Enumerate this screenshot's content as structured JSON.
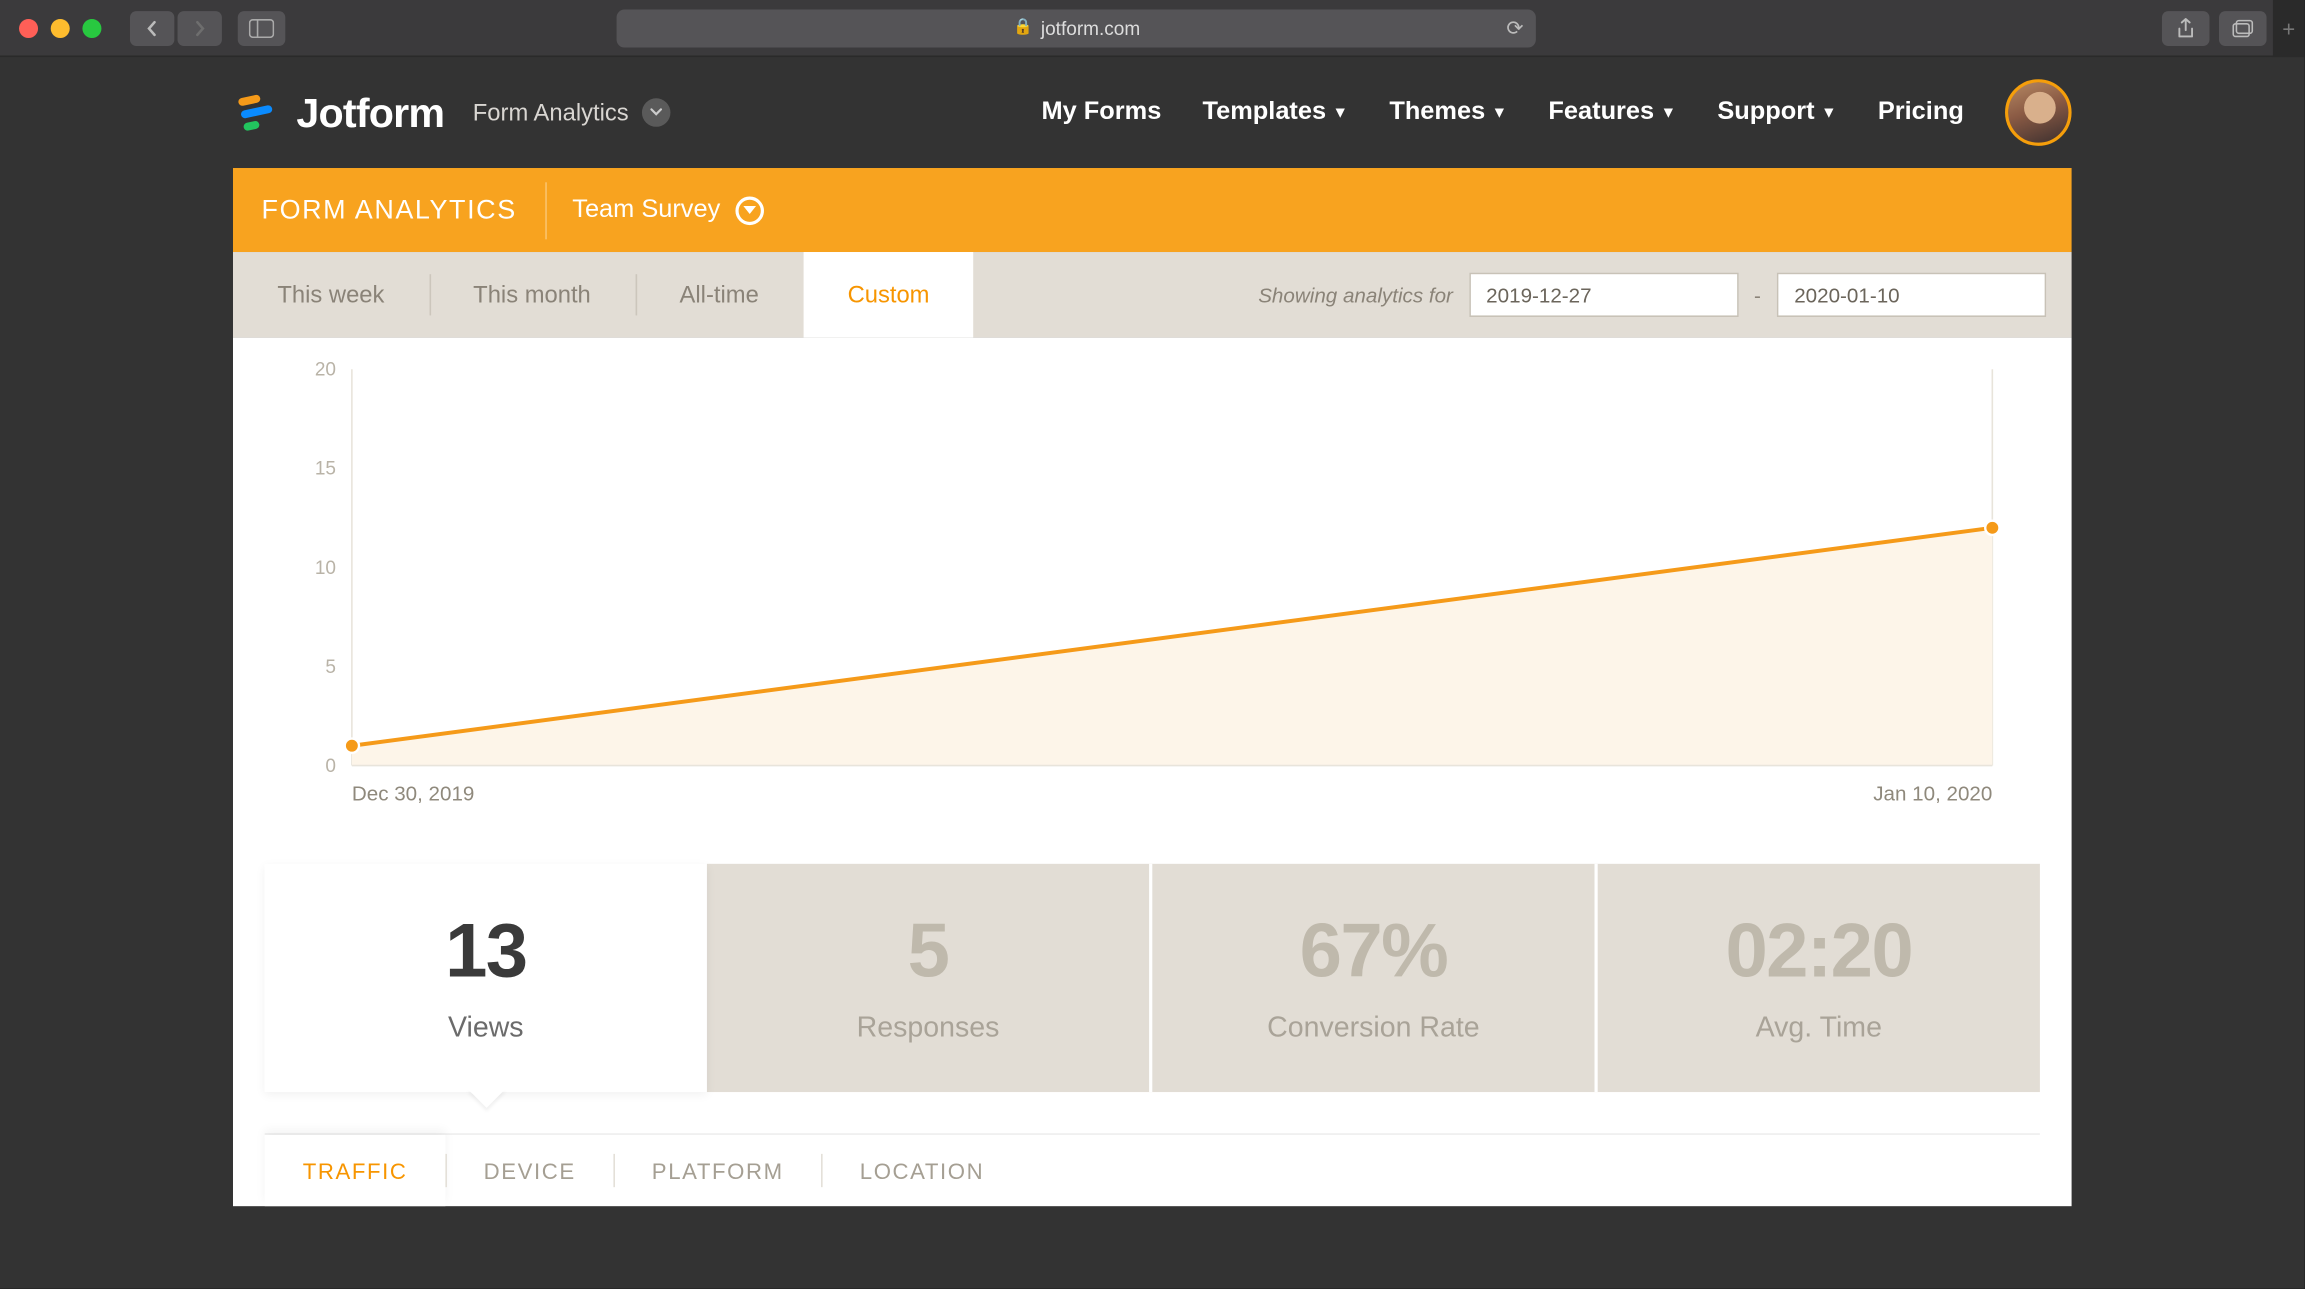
{
  "browser": {
    "url": "jotform.com"
  },
  "header": {
    "brand": "Jotform",
    "section": "Form Analytics",
    "nav": {
      "my_forms": "My Forms",
      "templates": "Templates",
      "themes": "Themes",
      "features": "Features",
      "support": "Support",
      "pricing": "Pricing"
    }
  },
  "orange_bar": {
    "title": "FORM ANALYTICS",
    "form_name": "Team Survey"
  },
  "range": {
    "tabs": {
      "week": "This week",
      "month": "This month",
      "all": "All-time",
      "custom": "Custom"
    },
    "label": "Showing analytics for",
    "from": "2019-12-27",
    "to": "2020-01-10"
  },
  "chart_data": {
    "type": "line",
    "x": [
      "Dec 30, 2019",
      "Jan 10, 2020"
    ],
    "values": [
      1,
      12
    ],
    "y_ticks": [
      0,
      5,
      10,
      15,
      20
    ],
    "ylim": [
      0,
      20
    ]
  },
  "stats": {
    "views": {
      "value": "13",
      "label": "Views"
    },
    "responses": {
      "value": "5",
      "label": "Responses"
    },
    "conversion": {
      "value": "67%",
      "label": "Conversion Rate"
    },
    "avg_time": {
      "value": "02:20",
      "label": "Avg. Time"
    }
  },
  "bottom_tabs": {
    "traffic": "TRAFFIC",
    "device": "DEVICE",
    "platform": "PLATFORM",
    "location": "LOCATION"
  },
  "colors": {
    "accent_orange": "#f8a31f",
    "line_orange": "#f59a19"
  }
}
